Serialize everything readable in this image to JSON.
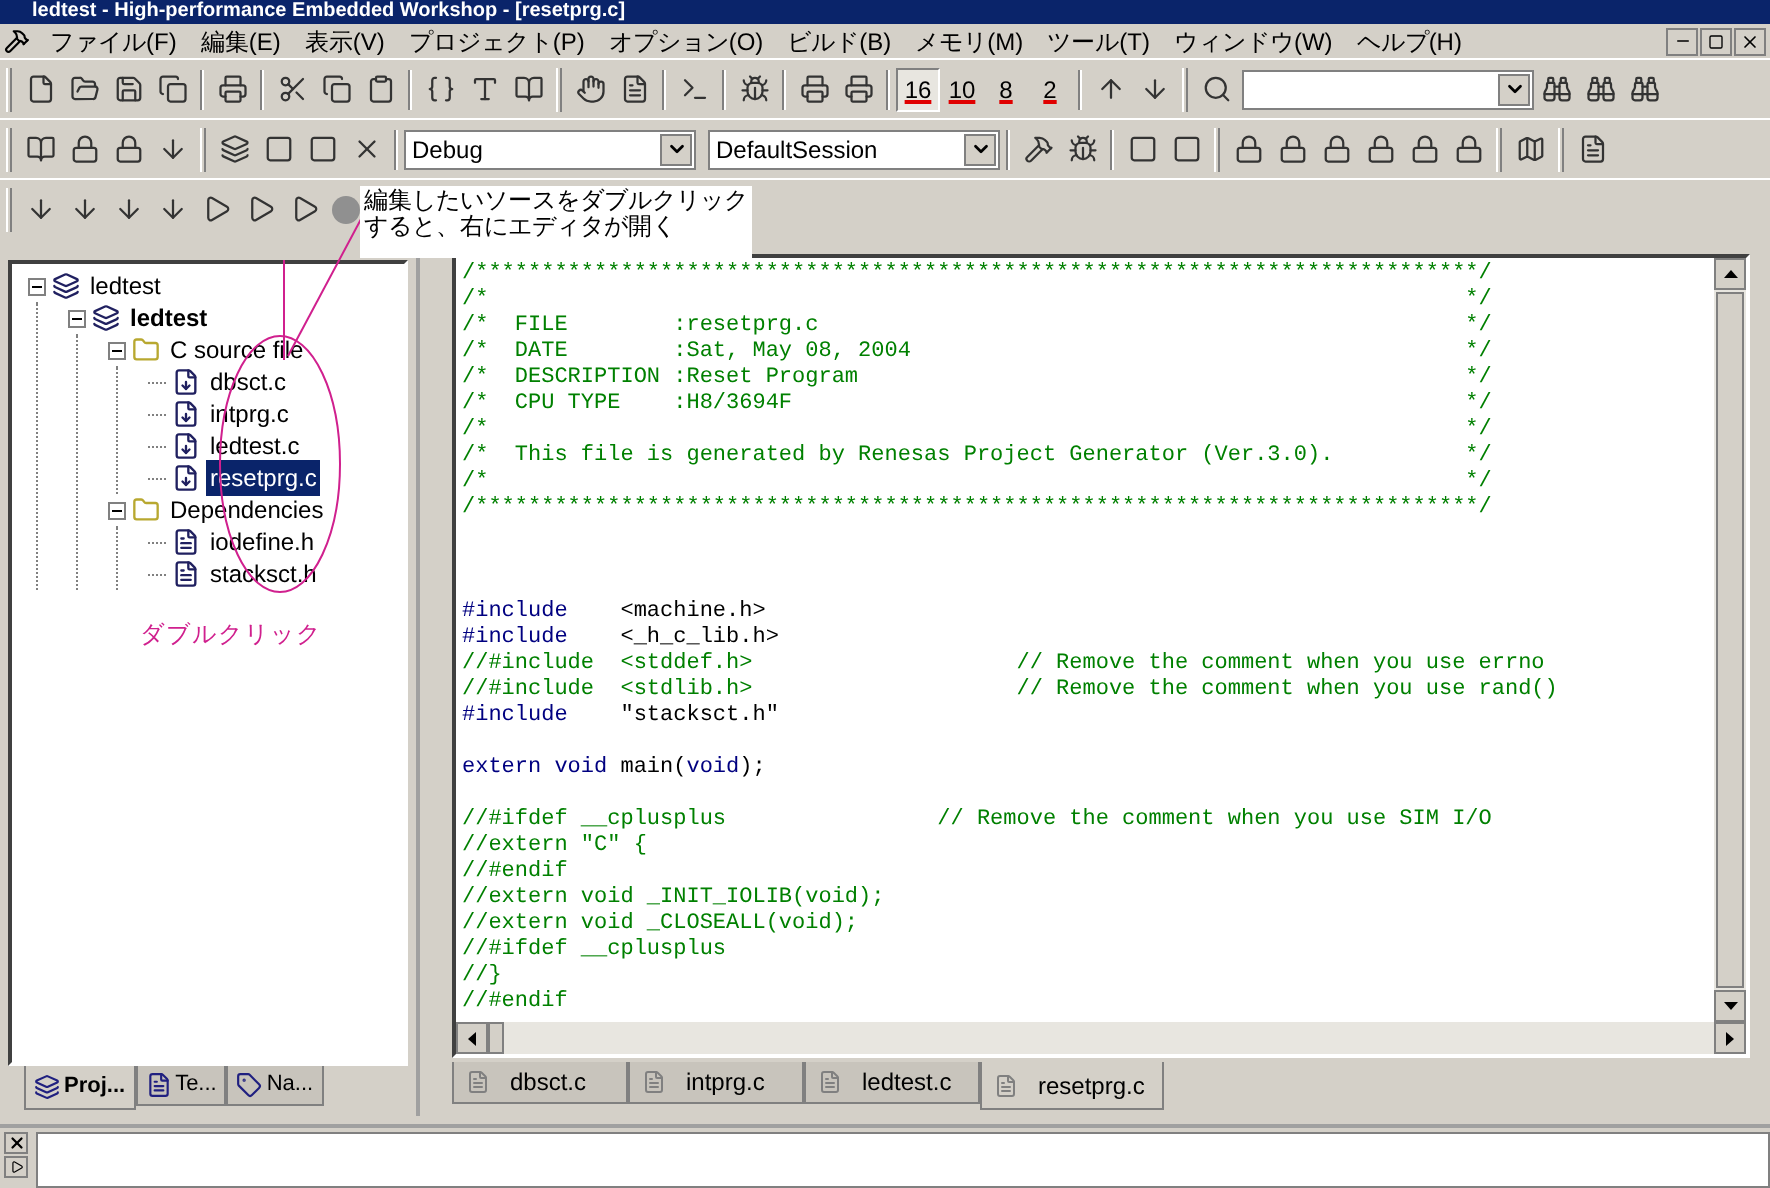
{
  "window": {
    "title": "ledtest - High-performance Embedded Workshop - [resetprg.c]"
  },
  "menu": [
    "ファイル(F)",
    "編集(E)",
    "表示(V)",
    "プロジェクト(P)",
    "オプション(O)",
    "ビルド(B)",
    "メモリ(M)",
    "ツール(T)",
    "ウィンドウ(W)",
    "ヘルプ(H)"
  ],
  "toolbar": {
    "radix_buttons": [
      {
        "label": "16",
        "selected": true
      },
      {
        "label": "10",
        "selected": false
      },
      {
        "label": "8",
        "selected": false
      },
      {
        "label": "2",
        "selected": false
      }
    ],
    "configuration": "Debug",
    "session": "DefaultSession"
  },
  "annotation": {
    "callout": [
      "編集したいソースをダブルクリック",
      "すると、右にエディタが開く"
    ],
    "label": "ダブルクリック"
  },
  "project_tree": [
    {
      "label": "ledtest",
      "kind": "workspace",
      "expanded": true,
      "selected": false,
      "children": [
        {
          "label": "ledtest",
          "kind": "project",
          "expanded": true,
          "selected": false,
          "children": [
            {
              "label": "C source file",
              "kind": "folder",
              "expanded": true,
              "selected": false,
              "children": [
                {
                  "label": "dbsct.c",
                  "kind": "source",
                  "selected": false
                },
                {
                  "label": "intprg.c",
                  "kind": "source",
                  "selected": false
                },
                {
                  "label": "ledtest.c",
                  "kind": "source",
                  "selected": false
                },
                {
                  "label": "resetprg.c",
                  "kind": "source",
                  "selected": true
                }
              ]
            },
            {
              "label": "Dependencies",
              "kind": "folder",
              "expanded": true,
              "selected": false,
              "children": [
                {
                  "label": "iodefine.h",
                  "kind": "header",
                  "selected": false
                },
                {
                  "label": "stacksct.h",
                  "kind": "header",
                  "selected": false
                }
              ]
            }
          ]
        }
      ]
    }
  ],
  "panel_tabs": [
    {
      "label": "Proj...",
      "kind": "projects",
      "selected": true
    },
    {
      "label": "Te...",
      "kind": "templates",
      "selected": false
    },
    {
      "label": "Na...",
      "kind": "navigation",
      "selected": false
    }
  ],
  "editor": {
    "lines": [
      {
        "kind": "code",
        "segments": [
          {
            "kind": "comment",
            "text": "/****************************************************************************/"
          }
        ]
      },
      {
        "kind": "code",
        "segments": [
          {
            "kind": "comment",
            "text": "/*                                                                          */"
          }
        ]
      },
      {
        "kind": "code",
        "segments": [
          {
            "kind": "comment",
            "text": "/*  FILE        :resetprg.c                                                 */"
          }
        ]
      },
      {
        "kind": "code",
        "segments": [
          {
            "kind": "comment",
            "text": "/*  DATE        :Sat, May 08, 2004                                          */"
          }
        ]
      },
      {
        "kind": "code",
        "segments": [
          {
            "kind": "comment",
            "text": "/*  DESCRIPTION :Reset Program                                              */"
          }
        ]
      },
      {
        "kind": "code",
        "segments": [
          {
            "kind": "comment",
            "text": "/*  CPU TYPE    :H8/3694F                                                   */"
          }
        ]
      },
      {
        "kind": "code",
        "segments": [
          {
            "kind": "comment",
            "text": "/*                                                                          */"
          }
        ]
      },
      {
        "kind": "code",
        "segments": [
          {
            "kind": "comment",
            "text": "/*  This file is generated by Renesas Project Generator (Ver.3.0).          */"
          }
        ]
      },
      {
        "kind": "code",
        "segments": [
          {
            "kind": "comment",
            "text": "/*                                                                          */"
          }
        ]
      },
      {
        "kind": "code",
        "segments": [
          {
            "kind": "comment",
            "text": "/****************************************************************************/"
          }
        ]
      },
      {
        "kind": "blank"
      },
      {
        "kind": "blank"
      },
      {
        "kind": "blank"
      },
      {
        "kind": "code",
        "segments": [
          {
            "kind": "keyword",
            "text": "#include"
          },
          {
            "kind": "plain",
            "text": "    <machine.h>"
          }
        ]
      },
      {
        "kind": "code",
        "segments": [
          {
            "kind": "keyword",
            "text": "#include"
          },
          {
            "kind": "plain",
            "text": "    <_h_c_lib.h>"
          }
        ]
      },
      {
        "kind": "code",
        "segments": [
          {
            "kind": "comment",
            "text": "//#include  <stddef.h>                    // Remove the comment when you use errno"
          }
        ]
      },
      {
        "kind": "code",
        "segments": [
          {
            "kind": "comment",
            "text": "//#include  <stdlib.h>                    // Remove the comment when you use rand()"
          }
        ]
      },
      {
        "kind": "code",
        "segments": [
          {
            "kind": "keyword",
            "text": "#include"
          },
          {
            "kind": "plain",
            "text": "    \"stacksct.h\""
          }
        ]
      },
      {
        "kind": "blank"
      },
      {
        "kind": "code",
        "segments": [
          {
            "kind": "keyword",
            "text": "extern void"
          },
          {
            "kind": "plain",
            "text": " main("
          },
          {
            "kind": "keyword",
            "text": "void"
          },
          {
            "kind": "plain",
            "text": ");"
          }
        ]
      },
      {
        "kind": "blank"
      },
      {
        "kind": "code",
        "segments": [
          {
            "kind": "comment",
            "text": "//#ifdef __cplusplus                // Remove the comment when you use SIM I/O"
          }
        ]
      },
      {
        "kind": "code",
        "segments": [
          {
            "kind": "comment",
            "text": "//extern \"C\" {"
          }
        ]
      },
      {
        "kind": "code",
        "segments": [
          {
            "kind": "comment",
            "text": "//#endif"
          }
        ]
      },
      {
        "kind": "code",
        "segments": [
          {
            "kind": "comment",
            "text": "//extern void _INIT_IOLIB(void);"
          }
        ]
      },
      {
        "kind": "code",
        "segments": [
          {
            "kind": "comment",
            "text": "//extern void _CLOSEALL(void);"
          }
        ]
      },
      {
        "kind": "code",
        "segments": [
          {
            "kind": "comment",
            "text": "//#ifdef __cplusplus"
          }
        ]
      },
      {
        "kind": "code",
        "segments": [
          {
            "kind": "comment",
            "text": "//}"
          }
        ]
      },
      {
        "kind": "code",
        "segments": [
          {
            "kind": "comment",
            "text": "//#endif"
          }
        ]
      }
    ]
  },
  "editor_tabs": [
    {
      "label": "dbsct.c",
      "selected": false
    },
    {
      "label": "intprg.c",
      "selected": false
    },
    {
      "label": "ledtest.c",
      "selected": false
    },
    {
      "label": "resetprg.c",
      "selected": true
    }
  ]
}
